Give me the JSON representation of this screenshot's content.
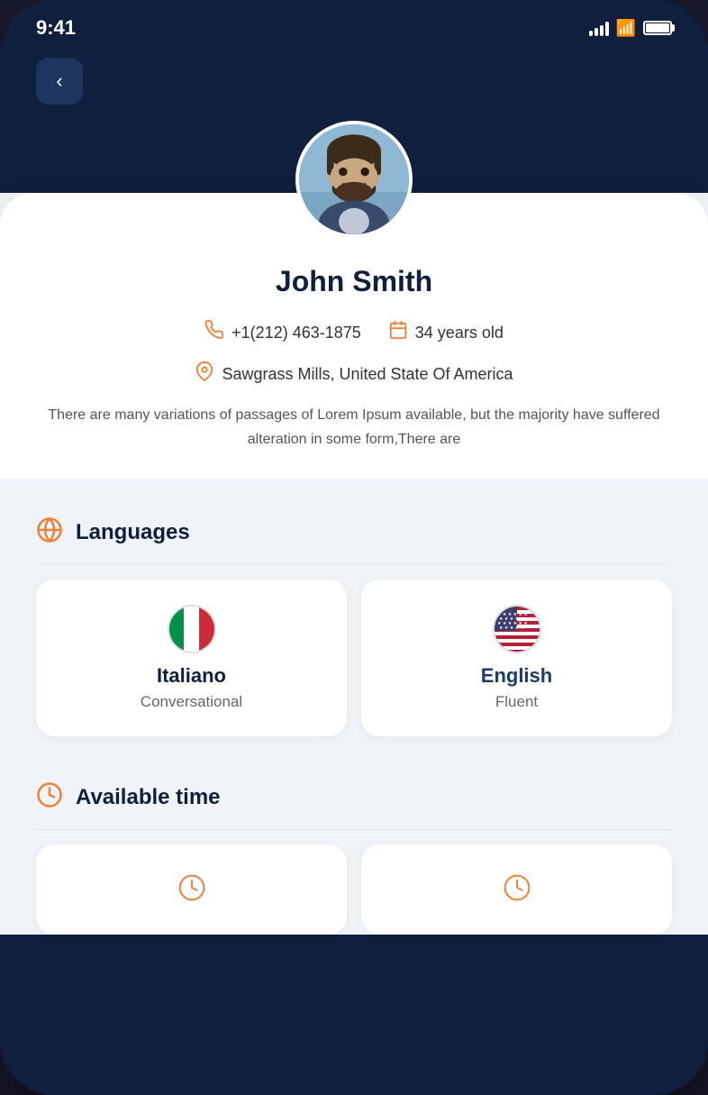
{
  "status_bar": {
    "time": "9:41"
  },
  "header": {
    "back_label": "‹"
  },
  "profile": {
    "name": "John Smith",
    "phone": "+1(212) 463-1875",
    "age": "34 years old",
    "location": "Sawgrass Mills, United State Of America",
    "bio": "There are many variations of passages of Lorem Ipsum available, but the majority have suffered alteration in some form,There are"
  },
  "languages": {
    "section_title": "Languages",
    "items": [
      {
        "name": "Italiano",
        "level": "Conversational",
        "flag_type": "italy"
      },
      {
        "name": "English",
        "level": "Fluent",
        "flag_type": "usa"
      }
    ]
  },
  "available_time": {
    "section_title": "Available time"
  },
  "icons": {
    "phone_icon": "📞",
    "calendar_icon": "📅",
    "location_icon": "📍",
    "globe_icon": "🌐",
    "clock_icon": "🕐"
  },
  "colors": {
    "orange": "#f0813a",
    "dark_blue": "#0f1f3d",
    "card_bg": "#f0f4f8"
  }
}
